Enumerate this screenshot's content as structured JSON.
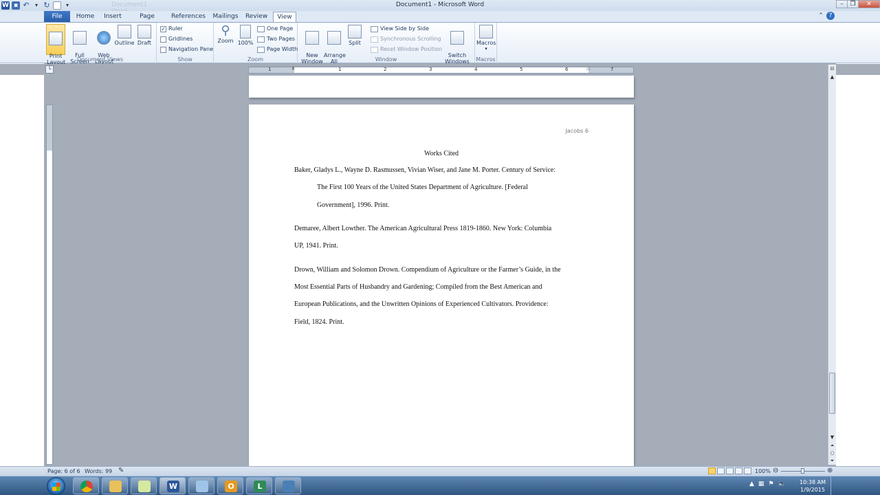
{
  "window": {
    "title": "Document1 - Microsoft Word",
    "ghost_title": "Document1 - Word"
  },
  "tabs": [
    "File",
    "Home",
    "Insert",
    "Page Layout",
    "References",
    "Mailings",
    "Review",
    "View"
  ],
  "active_tab": "View",
  "ribbon": {
    "document_views": {
      "label": "Document Views",
      "print_layout": "Print\nLayout",
      "full_screen": "Full Screen\nReading",
      "web_layout": "Web\nLayout",
      "outline": "Outline",
      "draft": "Draft"
    },
    "show": {
      "label": "Show",
      "ruler": "Ruler",
      "ruler_checked": true,
      "gridlines": "Gridlines",
      "gridlines_checked": false,
      "nav_pane": "Navigation Pane",
      "nav_pane_checked": false
    },
    "zoom": {
      "label": "Zoom",
      "zoom": "Zoom",
      "hundred": "100%",
      "one_page": "One Page",
      "two_pages": "Two Pages",
      "page_width": "Page Width"
    },
    "window": {
      "label": "Window",
      "new_window": "New\nWindow",
      "arrange_all": "Arrange\nAll",
      "split": "Split",
      "side_by_side": "View Side by Side",
      "sync_scroll": "Synchronous Scrolling",
      "reset_pos": "Reset Window Position",
      "switch": "Switch\nWindows ▾"
    },
    "macros": {
      "label": "Macros",
      "macros": "Macros"
    }
  },
  "ruler_numbers": [
    "1",
    "1",
    "2",
    "3",
    "4",
    "5",
    "6",
    "7"
  ],
  "document": {
    "header": "Jacobs 6",
    "title": "Works Cited",
    "citations": [
      {
        "lines": [
          "Baker, Gladys L., Wayne D. Rasmussen, Vivian Wiser, and Jane M. Porter. Century of Service:",
          "The First 100 Years of the United States Department of Agriculture. [Federal",
          "Government], 1996. Print."
        ]
      },
      {
        "lines": [
          "Demaree, Albert Lowther. The American Agricultural Press 1819-1860. New York: Columbia",
          "UP, 1941. Print."
        ]
      },
      {
        "lines": [
          "Drown, William  and Solomon Drown. Compendium of Agriculture or the Farmer’s Guide, in the",
          "Most Essential Parts of Husbandry and Gardening; Compiled from the Best American and",
          "European Publications, and the Unwritten Opinions of Experienced Cultivators. Providence:",
          "Field, 1824. Print."
        ]
      }
    ]
  },
  "status": {
    "page": "Page: 6 of 6",
    "words": "Words: 99",
    "zoom": "100%"
  },
  "taskbar": {
    "time": "10:38 AM",
    "date": "1/9/2015"
  }
}
